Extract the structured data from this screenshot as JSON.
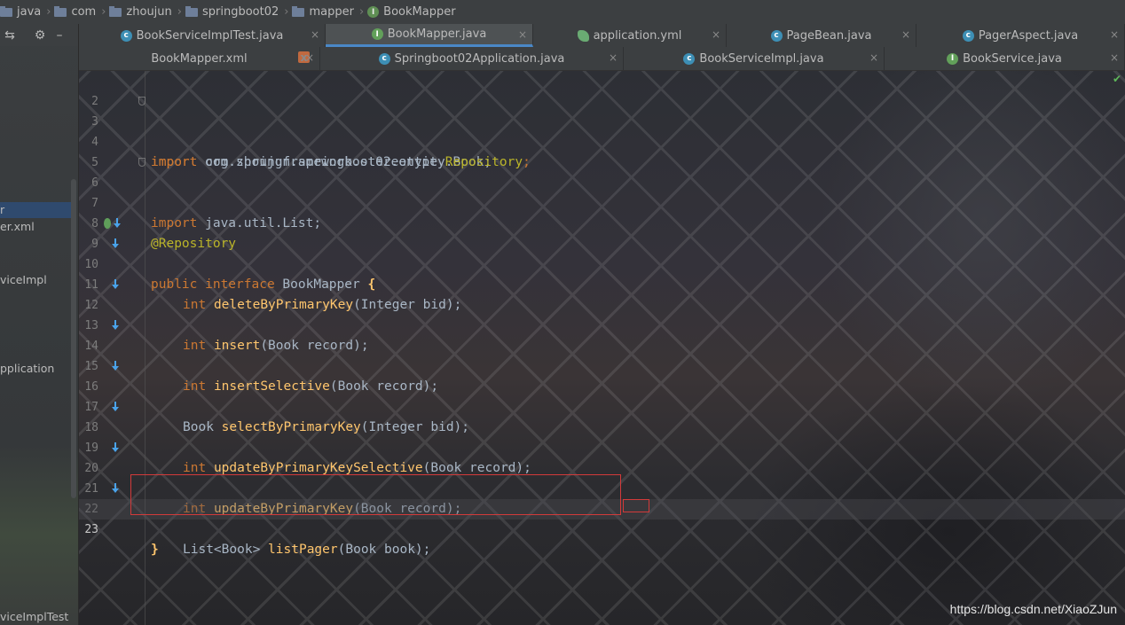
{
  "breadcrumb": [
    {
      "label": "java",
      "icon": "folder-icon"
    },
    {
      "label": "com",
      "icon": "folder-icon"
    },
    {
      "label": "zhoujun",
      "icon": "folder-icon"
    },
    {
      "label": "springboot02",
      "icon": "folder-icon"
    },
    {
      "label": "mapper",
      "icon": "folder-icon"
    },
    {
      "label": "BookMapper",
      "icon": "interface-icon"
    }
  ],
  "left_panel": {
    "tool_icons": [
      "hide-icon",
      "gear-icon",
      "minimize-icon"
    ],
    "items": [
      {
        "label": "r",
        "selected": true
      },
      {
        "label": "er.xml",
        "selected": false
      },
      {
        "label": "viceImpl",
        "selected": false
      },
      {
        "label": "pplication",
        "selected": false
      },
      {
        "label": "viceImplTest",
        "selected": false
      }
    ]
  },
  "tabs_row1": [
    {
      "label": "BookServiceImplTest.java",
      "icon": "class-icon",
      "active": false
    },
    {
      "label": "BookMapper.java",
      "icon": "interface-icon",
      "active": true
    },
    {
      "label": "application.yml",
      "icon": "yaml-icon",
      "active": false
    },
    {
      "label": "PageBean.java",
      "icon": "class-icon",
      "active": false
    },
    {
      "label": "PagerAspect.java",
      "icon": "class-icon",
      "active": false
    }
  ],
  "tabs_row2": [
    {
      "label": "BookMapper.xml",
      "icon": "xml-icon",
      "active": false
    },
    {
      "label": "Springboot02Application.java",
      "icon": "class-icon",
      "active": false
    },
    {
      "label": "BookServiceImpl.java",
      "icon": "class-icon",
      "active": false
    },
    {
      "label": "BookService.java",
      "icon": "interface-icon",
      "active": false
    }
  ],
  "close_label": "×",
  "code": {
    "line_numbers": [
      "2",
      "3",
      "4",
      "5",
      "6",
      "7",
      "8",
      "9",
      "10",
      "11",
      "12",
      "13",
      "14",
      "15",
      "16",
      "17",
      "18",
      "19",
      "20",
      "21",
      "22",
      "23"
    ],
    "current_line": "23",
    "l3": {
      "kw": "import",
      "rest": " com.zhoujun.springboot02.entity.Book;"
    },
    "l4": {
      "kw": "import",
      "pkg": " org.springframework.stereotype.",
      "cls": "Repository",
      "end": ";"
    },
    "l6": {
      "kw": "import",
      "rest": " java.util.List;"
    },
    "l8": {
      "annotation": "@Repository"
    },
    "l9": {
      "kw1": "public",
      "kw2": " interface",
      "name": " BookMapper ",
      "brace": "{"
    },
    "methods": [
      {
        "line": "10",
        "type": "int",
        "name": "deleteByPrimaryKey",
        "params": "(Integer bid);"
      },
      {
        "line": "12",
        "type": "int",
        "name": "insert",
        "params": "(Book record);"
      },
      {
        "line": "14",
        "type": "int",
        "name": "insertSelective",
        "params": "(Book record);"
      },
      {
        "line": "16",
        "type": "Book",
        "name": "selectByPrimaryKey",
        "params": "(Integer bid);"
      },
      {
        "line": "18",
        "type": "int",
        "name": "updateByPrimaryKeySelective",
        "params": "(Book record);"
      },
      {
        "line": "20",
        "type": "int",
        "name": "updateByPrimaryKey",
        "params": "(Book record);"
      },
      {
        "line": "22",
        "type": "List<Book>",
        "name": "listPager",
        "params": "(Book book);"
      }
    ],
    "l23": {
      "brace": "}"
    }
  },
  "watermark": "https://blog.csdn.net/XiaoZJun",
  "colors": {
    "keyword": "#cc7832",
    "method": "#ffc66d",
    "annotation": "#bbb529",
    "plain": "#a9b7c6",
    "highlight_box": "#d33a3a"
  }
}
